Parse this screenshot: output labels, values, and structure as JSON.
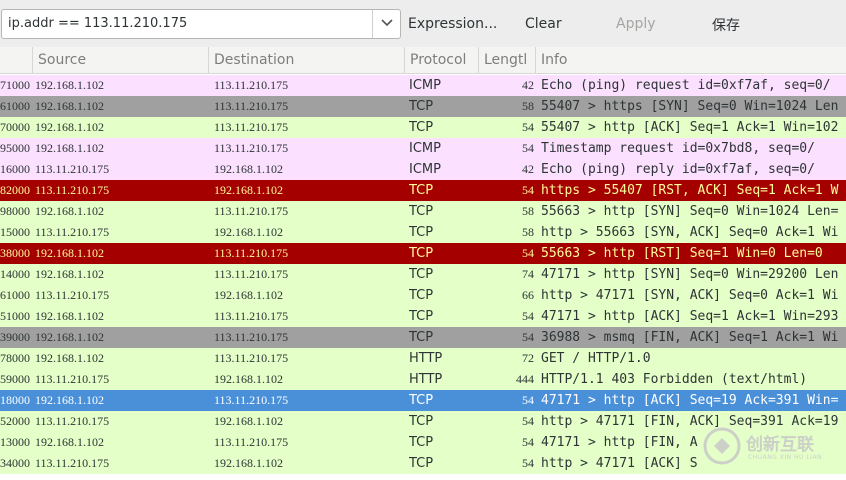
{
  "toolbar": {
    "filter_value": "ip.addr == 113.11.210.175",
    "expression_label": "Expression...",
    "clear_label": "Clear",
    "apply_label": "Apply",
    "save_label": "保存"
  },
  "columns": [
    "Source",
    "Destination",
    "Protocol",
    "Lengtl",
    "Info"
  ],
  "colors": {
    "icmp": "#fce0ff",
    "tcp": "#e4ffc7",
    "http": "#e4ffc7",
    "tcp_syn_fin": "#a0a0a0",
    "tcp_rst": "#a40000",
    "selected": "#4a90d9"
  },
  "rows": [
    {
      "time": "71000",
      "source": "192.168.1.102",
      "destination": "113.11.210.175",
      "protocol": "ICMP",
      "length": "42",
      "info": "Echo (ping) request  id=0xf7af, seq=0/",
      "style": "icmp"
    },
    {
      "time": "61000",
      "source": "192.168.1.102",
      "destination": "113.11.210.175",
      "protocol": "TCP",
      "length": "58",
      "info": "55407 > https [SYN] Seq=0 Win=1024 Len",
      "style": "tcp_syn_fin"
    },
    {
      "time": "70000",
      "source": "192.168.1.102",
      "destination": "113.11.210.175",
      "protocol": "TCP",
      "length": "54",
      "info": "55407 > http [ACK] Seq=1 Ack=1 Win=102",
      "style": "tcp"
    },
    {
      "time": "95000",
      "source": "192.168.1.102",
      "destination": "113.11.210.175",
      "protocol": "ICMP",
      "length": "54",
      "info": "Timestamp request    id=0x7bd8, seq=0/",
      "style": "icmp"
    },
    {
      "time": "16000",
      "source": "113.11.210.175",
      "destination": "192.168.1.102",
      "protocol": "ICMP",
      "length": "42",
      "info": "Echo (ping) reply    id=0xf7af, seq=0/",
      "style": "icmp"
    },
    {
      "time": "82000",
      "source": "113.11.210.175",
      "destination": "192.168.1.102",
      "protocol": "TCP",
      "length": "54",
      "info": "https > 55407 [RST, ACK] Seq=1 Ack=1 W",
      "style": "tcp_rst"
    },
    {
      "time": "98000",
      "source": "192.168.1.102",
      "destination": "113.11.210.175",
      "protocol": "TCP",
      "length": "58",
      "info": "55663 > http [SYN] Seq=0 Win=1024 Len=",
      "style": "tcp"
    },
    {
      "time": "15000",
      "source": "113.11.210.175",
      "destination": "192.168.1.102",
      "protocol": "TCP",
      "length": "58",
      "info": "http > 55663 [SYN, ACK] Seq=0 Ack=1 Wi",
      "style": "tcp"
    },
    {
      "time": "38000",
      "source": "192.168.1.102",
      "destination": "113.11.210.175",
      "protocol": "TCP",
      "length": "54",
      "info": "55663 > http [RST] Seq=1 Win=0 Len=0",
      "style": "tcp_rst"
    },
    {
      "time": "14000",
      "source": "192.168.1.102",
      "destination": "113.11.210.175",
      "protocol": "TCP",
      "length": "74",
      "info": "47171 > http [SYN] Seq=0 Win=29200 Len",
      "style": "tcp"
    },
    {
      "time": "61000",
      "source": "113.11.210.175",
      "destination": "192.168.1.102",
      "protocol": "TCP",
      "length": "66",
      "info": "http > 47171 [SYN, ACK] Seq=0 Ack=1 Wi",
      "style": "tcp"
    },
    {
      "time": "51000",
      "source": "192.168.1.102",
      "destination": "113.11.210.175",
      "protocol": "TCP",
      "length": "54",
      "info": "47171 > http [ACK] Seq=1 Ack=1 Win=293",
      "style": "tcp"
    },
    {
      "time": "39000",
      "source": "192.168.1.102",
      "destination": "113.11.210.175",
      "protocol": "TCP",
      "length": "54",
      "info": "36988 > msmq [FIN, ACK] Seq=1 Ack=1 Wi",
      "style": "tcp_syn_fin"
    },
    {
      "time": "78000",
      "source": "192.168.1.102",
      "destination": "113.11.210.175",
      "protocol": "HTTP",
      "length": "72",
      "info": "GET / HTTP/1.0",
      "style": "http"
    },
    {
      "time": "59000",
      "source": "113.11.210.175",
      "destination": "192.168.1.102",
      "protocol": "HTTP",
      "length": "444",
      "info": "HTTP/1.1 403 Forbidden  (text/html)",
      "style": "http"
    },
    {
      "time": "18000",
      "source": "192.168.1.102",
      "destination": "113.11.210.175",
      "protocol": "TCP",
      "length": "54",
      "info": "47171 > http [ACK] Seq=19 Ack=391 Win=",
      "style": "selected"
    },
    {
      "time": "52000",
      "source": "113.11.210.175",
      "destination": "192.168.1.102",
      "protocol": "TCP",
      "length": "54",
      "info": "http > 47171 [FIN, ACK] Seq=391 Ack=19",
      "style": "tcp"
    },
    {
      "time": "13000",
      "source": "192.168.1.102",
      "destination": "113.11.210.175",
      "protocol": "TCP",
      "length": "54",
      "info": "47171 > http [FIN, A",
      "style": "tcp"
    },
    {
      "time": "34000",
      "source": "113.11.210.175",
      "destination": "192.168.1.102",
      "protocol": "TCP",
      "length": "54",
      "info": "http > 47171 [ACK] S",
      "style": "tcp"
    }
  ],
  "watermark": {
    "text": "创新互联",
    "subtext": "CHUANG XIN HU LIAN"
  }
}
